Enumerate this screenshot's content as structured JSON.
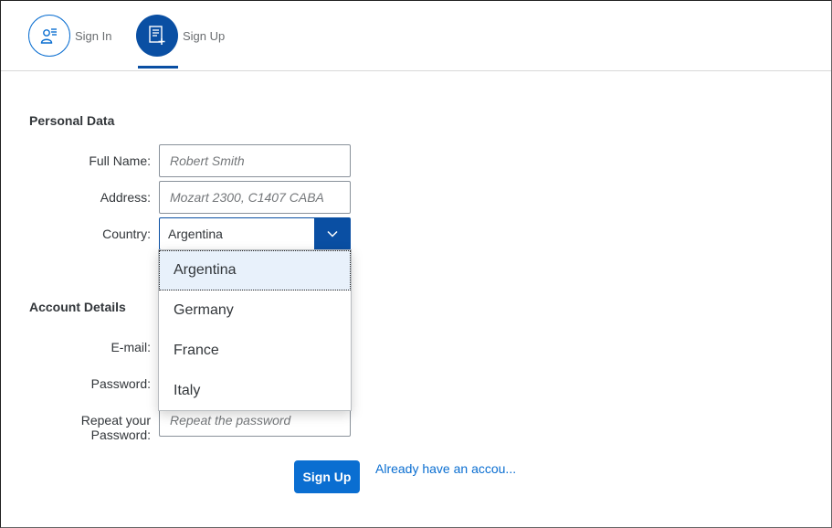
{
  "tabs": [
    {
      "label": "Sign In",
      "icon": "user-list-icon"
    },
    {
      "label": "Sign Up",
      "icon": "form-add-icon"
    }
  ],
  "personal": {
    "title": "Personal Data",
    "full_name_label": "Full Name:",
    "full_name_placeholder": "Robert Smith",
    "address_label": "Address:",
    "address_placeholder": "Mozart 2300, C1407 CABA",
    "country_label": "Country:",
    "country_value": "Argentina"
  },
  "country_options": [
    "Argentina",
    "Germany",
    "France",
    "Italy"
  ],
  "account": {
    "title": "Account Details",
    "email_label": "E-mail:",
    "password_label": "Password:",
    "repeat_label_line1": "Repeat your",
    "repeat_label_line2": "Password:",
    "repeat_placeholder": "Repeat the password"
  },
  "actions": {
    "signup_label": "Sign Up",
    "signin_link": "Already have an accou..."
  },
  "colors": {
    "accent": "#0a6ed1",
    "accent_dark": "#0a4fa3",
    "selected_bg": "#e8f1fb"
  }
}
